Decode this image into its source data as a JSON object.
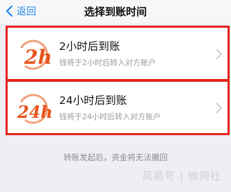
{
  "nav": {
    "back_label": "返回",
    "title": "选择到账时间"
  },
  "options": [
    {
      "title": "2小时后到账",
      "desc": "钱将于2小时后转入对方账户",
      "logo_text": "2h",
      "selected_highlight": true
    },
    {
      "title": "24小时后到账",
      "desc": "钱将于24小时后转入对方账户",
      "logo_text": "24h",
      "selected_highlight": true
    }
  ],
  "note": "转账发起后，资金将无法撤回",
  "watermark": "风易号 | 微网社",
  "colors": {
    "accent_blue": "#1f86f0",
    "highlight_red": "#e2231c",
    "logo_orange": "#e8531c",
    "background": "#eeeef3"
  },
  "icons": {
    "back": "chevron-left-icon",
    "row_arrow": "chevron-right-icon",
    "logo_2h": "clock-2h-logo",
    "logo_24h": "clock-24h-logo"
  }
}
